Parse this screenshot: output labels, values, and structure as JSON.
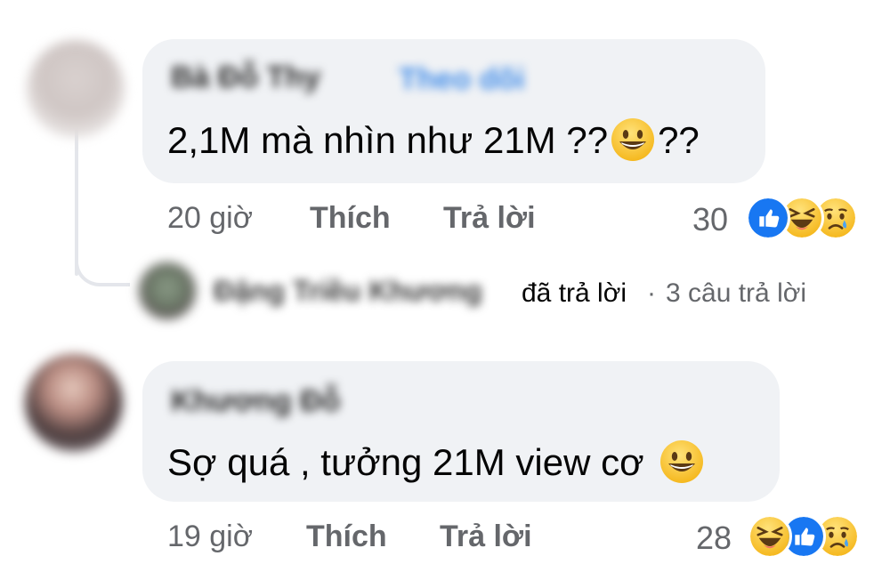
{
  "comments": [
    {
      "author_name": "Bà Đỗ Thy",
      "follow_label": "Theo dõi",
      "text_before_emoji": "2,1M mà nhìn như 21M ??",
      "text_after_emoji": "??",
      "time": "20 giờ",
      "like_label": "Thích",
      "reply_label": "Trả lời",
      "reaction_count": "30",
      "reactions": [
        "like-icon",
        "haha-icon",
        "sad-icon"
      ]
    },
    {
      "author_name": "Khương Đỗ",
      "text_before_emoji": "Sợ quá , tưởng 21M view cơ",
      "time": "19 giờ",
      "like_label": "Thích",
      "reply_label": "Trả lời",
      "reaction_count": "28",
      "reactions": [
        "haha-icon",
        "like-icon",
        "sad-icon"
      ]
    }
  ],
  "reply_summary": {
    "replier_name": "Đặng Triều Khương",
    "action_text": "đã trả lời",
    "separator": "·",
    "reply_count_text": "3 câu trả lời"
  },
  "colors": {
    "bubble": "#f0f2f5",
    "meta_text": "#65676b",
    "like_blue": "#1877f2",
    "emoji_yellow": "#f7c52e"
  }
}
